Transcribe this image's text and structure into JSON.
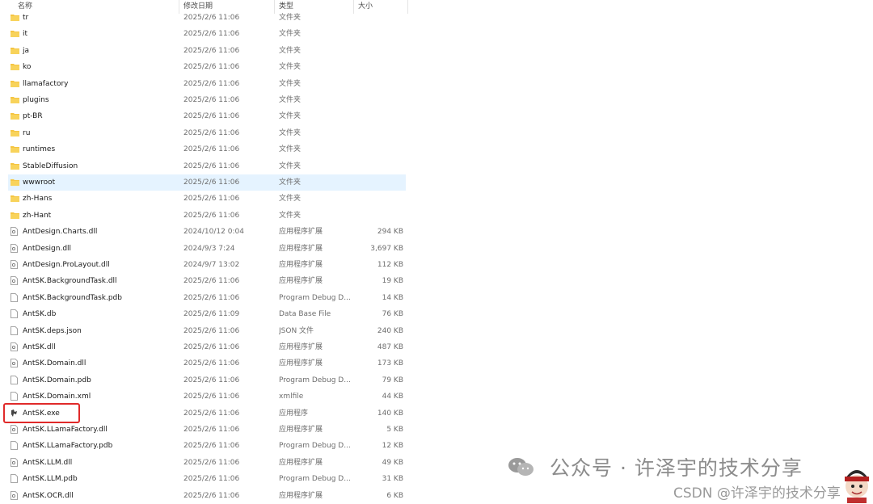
{
  "header": {
    "name_label": "名称",
    "date_label": "修改日期",
    "type_label": "类型",
    "size_label": "大小"
  },
  "files": [
    {
      "name": "tr",
      "date": "2025/2/6 11:06",
      "type": "文件夹",
      "size": "",
      "kind": "folder"
    },
    {
      "name": "it",
      "date": "2025/2/6 11:06",
      "type": "文件夹",
      "size": "",
      "kind": "folder"
    },
    {
      "name": "ja",
      "date": "2025/2/6 11:06",
      "type": "文件夹",
      "size": "",
      "kind": "folder"
    },
    {
      "name": "ko",
      "date": "2025/2/6 11:06",
      "type": "文件夹",
      "size": "",
      "kind": "folder"
    },
    {
      "name": "llamafactory",
      "date": "2025/2/6 11:06",
      "type": "文件夹",
      "size": "",
      "kind": "folder"
    },
    {
      "name": "plugins",
      "date": "2025/2/6 11:06",
      "type": "文件夹",
      "size": "",
      "kind": "folder"
    },
    {
      "name": "pt-BR",
      "date": "2025/2/6 11:06",
      "type": "文件夹",
      "size": "",
      "kind": "folder"
    },
    {
      "name": "ru",
      "date": "2025/2/6 11:06",
      "type": "文件夹",
      "size": "",
      "kind": "folder"
    },
    {
      "name": "runtimes",
      "date": "2025/2/6 11:06",
      "type": "文件夹",
      "size": "",
      "kind": "folder"
    },
    {
      "name": "StableDiffusion",
      "date": "2025/2/6 11:06",
      "type": "文件夹",
      "size": "",
      "kind": "folder"
    },
    {
      "name": "wwwroot",
      "date": "2025/2/6 11:06",
      "type": "文件夹",
      "size": "",
      "kind": "folder",
      "selected": true
    },
    {
      "name": "zh-Hans",
      "date": "2025/2/6 11:06",
      "type": "文件夹",
      "size": "",
      "kind": "folder"
    },
    {
      "name": "zh-Hant",
      "date": "2025/2/6 11:06",
      "type": "文件夹",
      "size": "",
      "kind": "folder"
    },
    {
      "name": "AntDesign.Charts.dll",
      "date": "2024/10/12 0:04",
      "type": "应用程序扩展",
      "size": "294 KB",
      "kind": "dll"
    },
    {
      "name": "AntDesign.dll",
      "date": "2024/9/3 7:24",
      "type": "应用程序扩展",
      "size": "3,697 KB",
      "kind": "dll"
    },
    {
      "name": "AntDesign.ProLayout.dll",
      "date": "2024/9/7 13:02",
      "type": "应用程序扩展",
      "size": "112 KB",
      "kind": "dll"
    },
    {
      "name": "AntSK.BackgroundTask.dll",
      "date": "2025/2/6 11:06",
      "type": "应用程序扩展",
      "size": "19 KB",
      "kind": "dll"
    },
    {
      "name": "AntSK.BackgroundTask.pdb",
      "date": "2025/2/6 11:06",
      "type": "Program Debug D...",
      "size": "14 KB",
      "kind": "file"
    },
    {
      "name": "AntSK.db",
      "date": "2025/2/6 11:09",
      "type": "Data Base File",
      "size": "76 KB",
      "kind": "file"
    },
    {
      "name": "AntSK.deps.json",
      "date": "2025/2/6 11:06",
      "type": "JSON 文件",
      "size": "240 KB",
      "kind": "file"
    },
    {
      "name": "AntSK.dll",
      "date": "2025/2/6 11:06",
      "type": "应用程序扩展",
      "size": "487 KB",
      "kind": "dll"
    },
    {
      "name": "AntSK.Domain.dll",
      "date": "2025/2/6 11:06",
      "type": "应用程序扩展",
      "size": "173 KB",
      "kind": "dll"
    },
    {
      "name": "AntSK.Domain.pdb",
      "date": "2025/2/6 11:06",
      "type": "Program Debug D...",
      "size": "79 KB",
      "kind": "file"
    },
    {
      "name": "AntSK.Domain.xml",
      "date": "2025/2/6 11:06",
      "type": "xmlfile",
      "size": "44 KB",
      "kind": "file"
    },
    {
      "name": "AntSK.exe",
      "date": "2025/2/6 11:06",
      "type": "应用程序",
      "size": "140 KB",
      "kind": "exe"
    },
    {
      "name": "AntSK.LLamaFactory.dll",
      "date": "2025/2/6 11:06",
      "type": "应用程序扩展",
      "size": "5 KB",
      "kind": "dll"
    },
    {
      "name": "AntSK.LLamaFactory.pdb",
      "date": "2025/2/6 11:06",
      "type": "Program Debug D...",
      "size": "12 KB",
      "kind": "file"
    },
    {
      "name": "AntSK.LLM.dll",
      "date": "2025/2/6 11:06",
      "type": "应用程序扩展",
      "size": "49 KB",
      "kind": "dll"
    },
    {
      "name": "AntSK.LLM.pdb",
      "date": "2025/2/6 11:06",
      "type": "Program Debug D...",
      "size": "31 KB",
      "kind": "file"
    },
    {
      "name": "AntSK.OCR.dll",
      "date": "2025/2/6 11:06",
      "type": "应用程序扩展",
      "size": "6 KB",
      "kind": "dll"
    }
  ],
  "watermark": {
    "main": "公众号 · 许泽宇的技术分享",
    "sub": "CSDN @许泽宇的技术分享"
  },
  "colors": {
    "folder": "#f5c542",
    "selection": "#e5f3ff",
    "highlight": "#e02a2a"
  }
}
